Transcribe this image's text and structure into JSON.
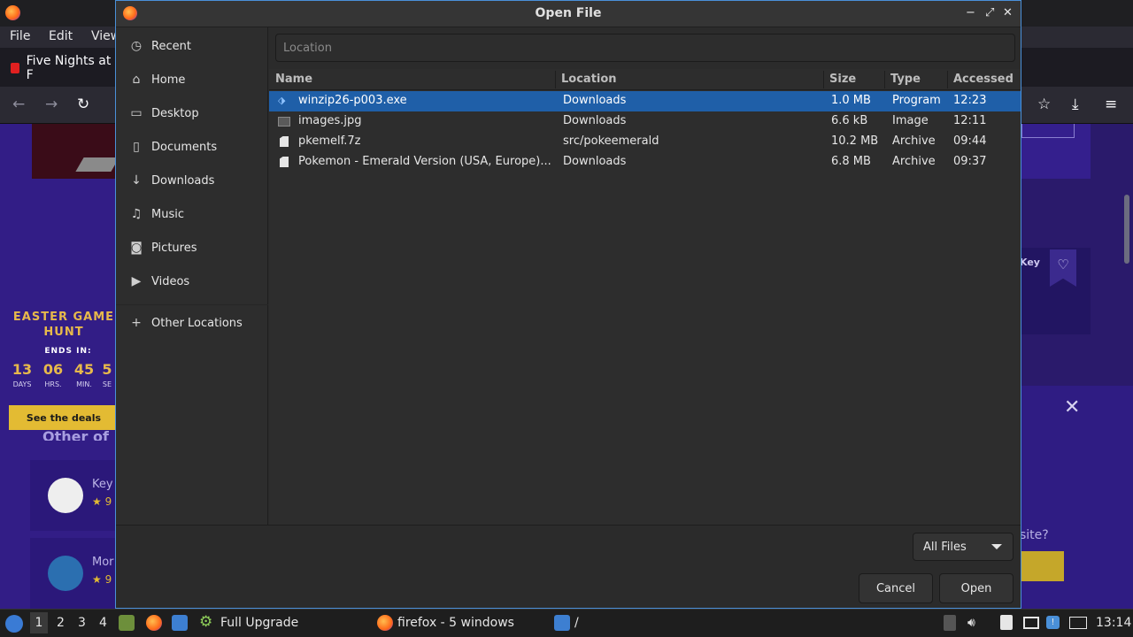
{
  "firefox": {
    "menu": {
      "file": "File",
      "edit": "Edit",
      "view": "View"
    },
    "tab_title": "Five Nights at F",
    "page": {
      "promo_title": "EASTER GAME HUNT",
      "ends_in": "ENDS IN:",
      "countdown": [
        {
          "value": "13",
          "unit": "DAYS"
        },
        {
          "value": "06",
          "unit": "HRS."
        },
        {
          "value": "45",
          "unit": "MIN."
        },
        {
          "value": "5",
          "unit": "SE"
        }
      ],
      "deals_button": "See the deals",
      "other_offers": "Other of",
      "cards": [
        {
          "title": "Key",
          "rating": "9"
        },
        {
          "title": "Mor",
          "rating": "9"
        }
      ],
      "right_key": "Key",
      "right_site": "site?"
    }
  },
  "dialog": {
    "title": "Open File",
    "places": [
      {
        "label": "Recent",
        "icon": "clock-icon",
        "glyph": "◷"
      },
      {
        "label": "Home",
        "icon": "home-icon",
        "glyph": "⌂"
      },
      {
        "label": "Desktop",
        "icon": "folder-icon",
        "glyph": "▭"
      },
      {
        "label": "Documents",
        "icon": "document-icon",
        "glyph": "▯"
      },
      {
        "label": "Downloads",
        "icon": "download-icon",
        "glyph": "↓"
      },
      {
        "label": "Music",
        "icon": "music-icon",
        "glyph": "♫"
      },
      {
        "label": "Pictures",
        "icon": "camera-icon",
        "glyph": "◙"
      },
      {
        "label": "Videos",
        "icon": "video-icon",
        "glyph": "▶"
      }
    ],
    "other_locations": {
      "label": "Other Locations",
      "icon": "plus-icon",
      "glyph": "+"
    },
    "location_placeholder": "Location",
    "columns": {
      "name": "Name",
      "location": "Location",
      "size": "Size",
      "type": "Type",
      "accessed": "Accessed"
    },
    "files": [
      {
        "name": "winzip26-p003.exe",
        "location": "Downloads",
        "size": "1.0 MB",
        "type": "Program",
        "accessed": "12:23",
        "icon": "executable-icon",
        "selected": true
      },
      {
        "name": "images.jpg",
        "location": "Downloads",
        "size": "6.6 kB",
        "type": "Image",
        "accessed": "12:11",
        "icon": "image-file-icon",
        "selected": false
      },
      {
        "name": "pkemelf.7z",
        "location": "src/pokeemerald",
        "size": "10.2 MB",
        "type": "Archive",
        "accessed": "09:44",
        "icon": "archive-icon",
        "selected": false
      },
      {
        "name": "Pokemon - Emerald Version (USA, Europe)...",
        "location": "Downloads",
        "size": "6.8 MB",
        "type": "Archive",
        "accessed": "09:37",
        "icon": "archive-icon",
        "selected": false
      }
    ],
    "filter": "All Files",
    "cancel": "Cancel",
    "open": "Open"
  },
  "taskbar": {
    "workspaces": [
      "1",
      "2",
      "3",
      "4"
    ],
    "upgrade_task": "Full Upgrade",
    "firefox_task": "firefox - 5 windows",
    "folder_task": "/",
    "clock": "13:14"
  }
}
